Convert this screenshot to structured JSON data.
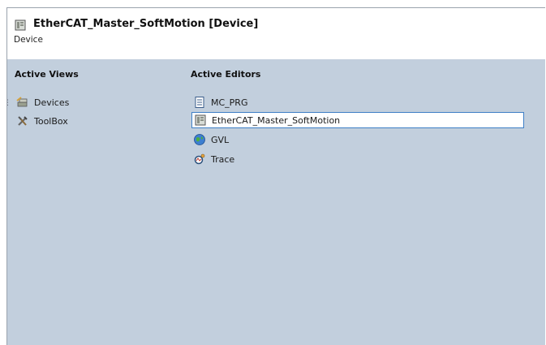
{
  "header": {
    "title": "EtherCAT_Master_SoftMotion [Device]",
    "subtitle": "Device"
  },
  "active_views": {
    "title": "Active Views",
    "items": [
      {
        "label": "Devices",
        "icon": "devices-icon"
      },
      {
        "label": "ToolBox",
        "icon": "toolbox-icon"
      }
    ]
  },
  "active_editors": {
    "title": "Active Editors",
    "items": [
      {
        "label": "MC_PRG",
        "icon": "document-icon"
      },
      {
        "label": "EtherCAT_Master_SoftMotion",
        "icon": "device-icon",
        "selected": true
      },
      {
        "label": "GVL",
        "icon": "globe-icon"
      },
      {
        "label": "Trace",
        "icon": "trace-icon"
      }
    ]
  },
  "colors": {
    "panel_bg": "#c2cfdd",
    "selection_border": "#3f7fc6"
  }
}
